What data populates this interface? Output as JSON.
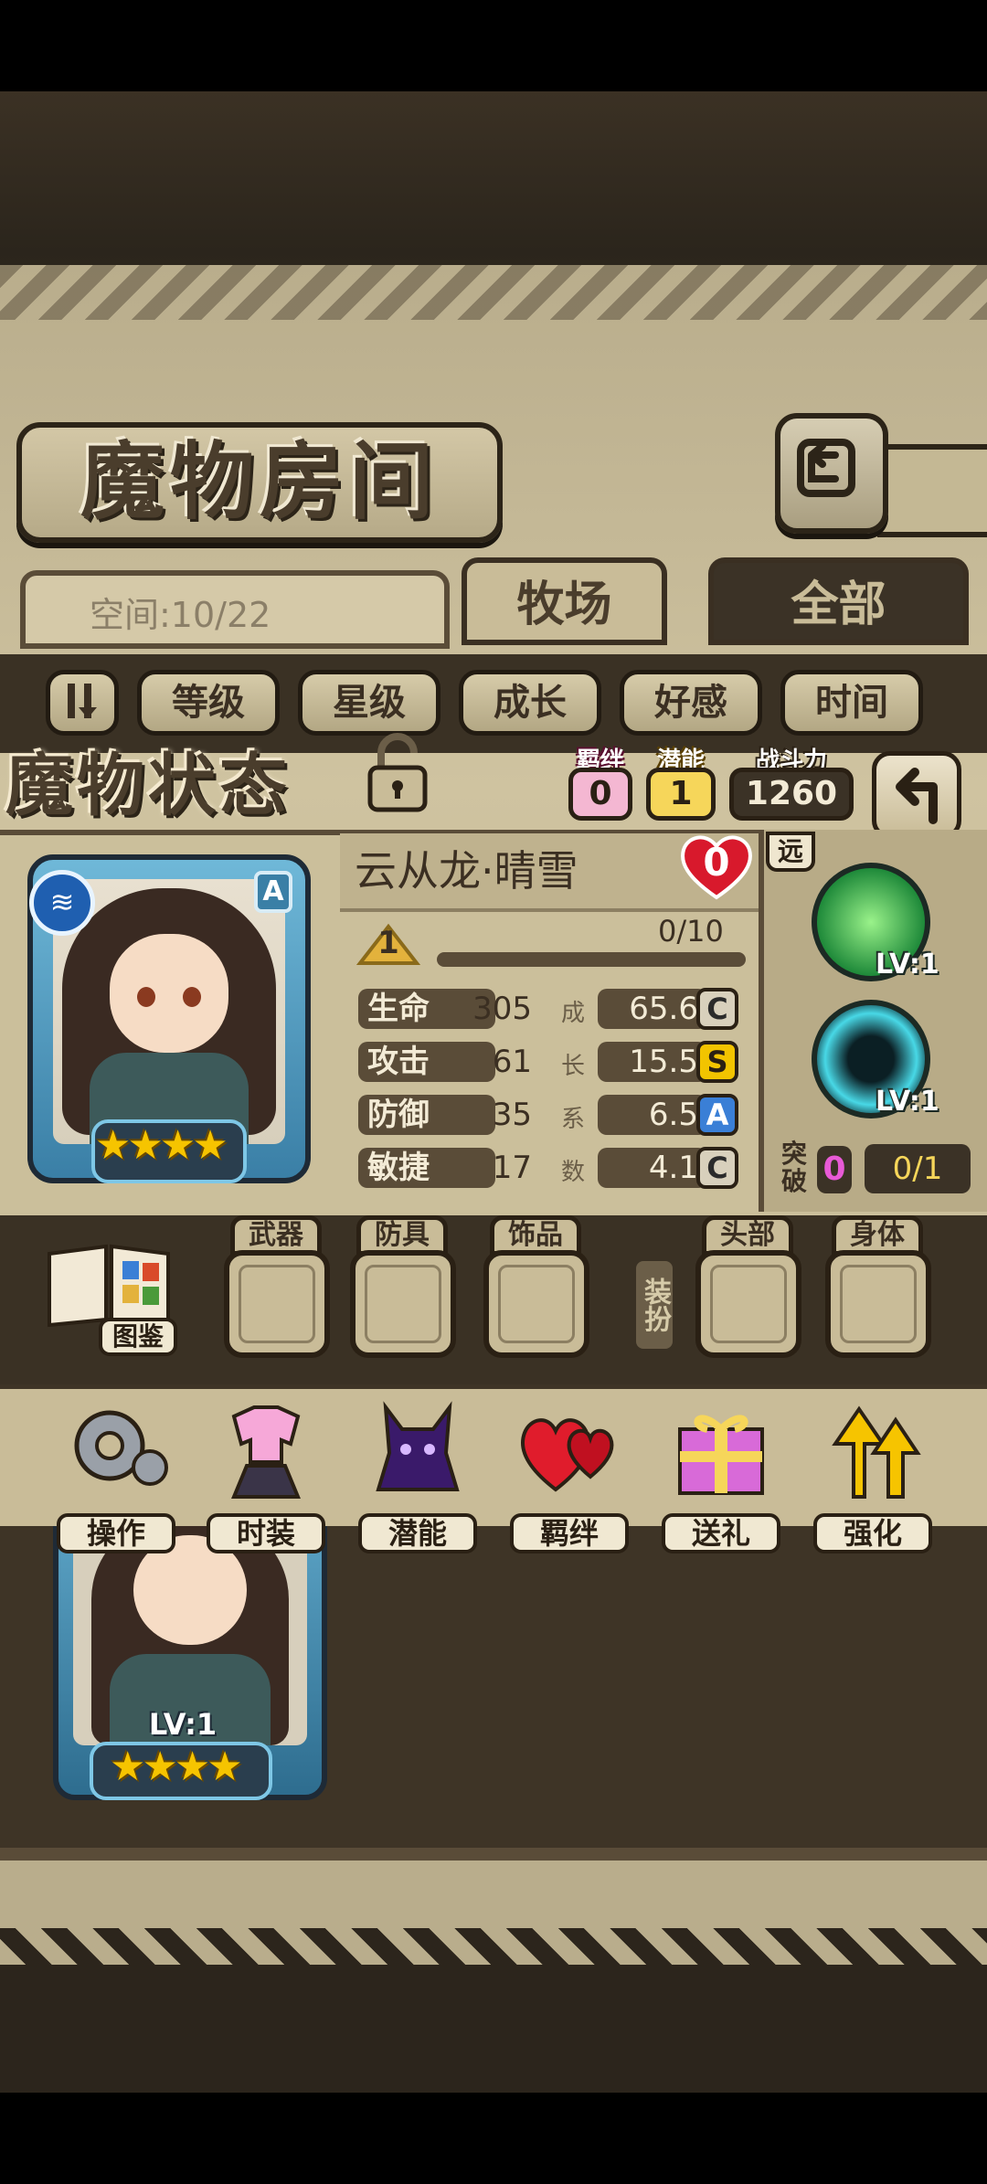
{
  "header": {
    "title": "魔物房间"
  },
  "tabs": {
    "space_label": "空间:10/22",
    "active": "牧场",
    "other": "全部"
  },
  "filters": {
    "sort_icon": "sort-icon",
    "buttons": [
      "等级",
      "星级",
      "成长",
      "好感",
      "时间"
    ]
  },
  "status": {
    "title": "魔物状态",
    "bond_label": "羁绊",
    "bond_value": "0",
    "potential_label": "潜能",
    "potential_value": "1",
    "power_label": "战斗力",
    "power_value": "1260"
  },
  "monster": {
    "name": "云从龙·晴雪",
    "heart_value": "0",
    "rank": "A",
    "level": "1",
    "exp": "0/10",
    "stars": 4,
    "stats": [
      {
        "label": "生命",
        "value": "305",
        "growth": "65.6",
        "grade": "C"
      },
      {
        "label": "攻击",
        "value": "61",
        "growth": "15.5",
        "grade": "S"
      },
      {
        "label": "防御",
        "value": "35",
        "growth": "6.5",
        "grade": "A"
      },
      {
        "label": "敏捷",
        "value": "17",
        "growth": "4.1",
        "grade": "C"
      }
    ],
    "growth_chars": [
      "成",
      "长",
      "系",
      "数"
    ]
  },
  "skills": {
    "range_label": "远",
    "skill1_lv": "LV:1",
    "skill2_lv": "LV:1",
    "breakthrough_label1": "突",
    "breakthrough_label2": "破",
    "breakthrough_count": "0",
    "breakthrough_progress": "0/1"
  },
  "equipment": {
    "book_label": "图鉴",
    "slots": [
      "武器",
      "防具",
      "饰品",
      "头部",
      "身体"
    ],
    "dress_label": "装扮"
  },
  "actions": [
    "操作",
    "时装",
    "潜能",
    "羁绊",
    "送礼",
    "强化"
  ],
  "list": {
    "card_level": "LV:1",
    "card_stars": 4
  },
  "colors": {
    "grade_C": "#2b2b2b",
    "grade_S": "#f2c400",
    "grade_A": "#3a7fd6",
    "bond_box": "#f4b7d2",
    "potential_box": "#f6d65a"
  }
}
